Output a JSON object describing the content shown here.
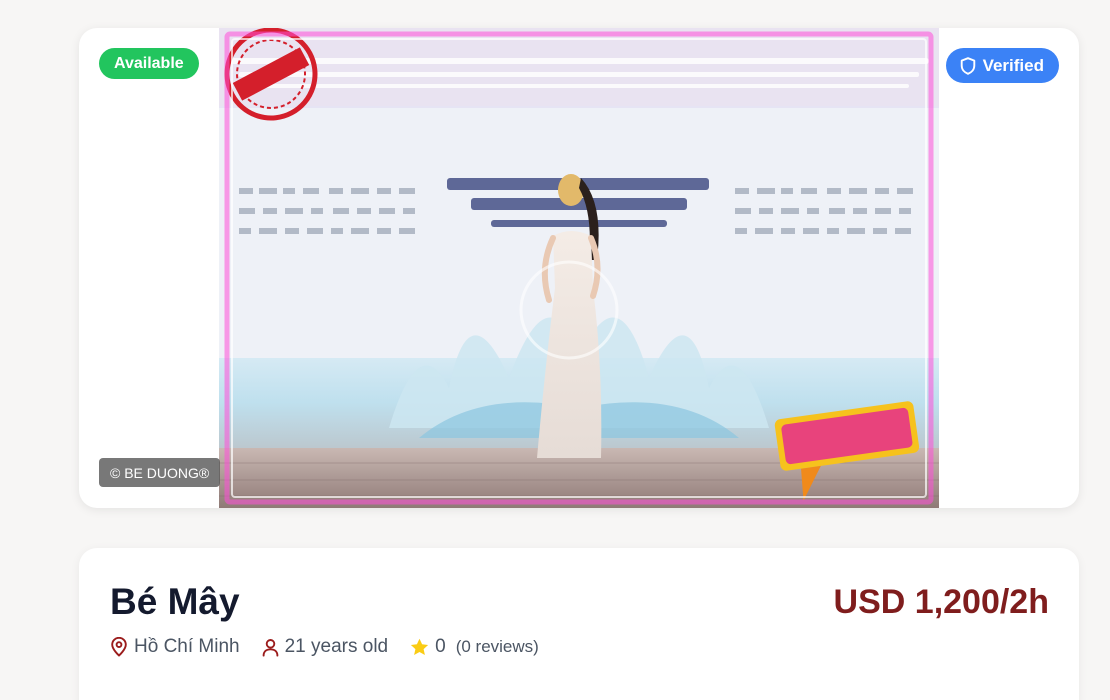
{
  "listing": {
    "status_badge": "Available",
    "verified_badge": "Verified",
    "photo_watermark": "© BE DUONG®",
    "photo_alt": "Profile photo"
  },
  "profile": {
    "name": "Bé Mây",
    "price": "USD 1,200/2h",
    "location": "Hồ Chí Minh",
    "age": "21 years old",
    "rating": "0",
    "reviews": "(0 reviews)"
  },
  "icons": {
    "verified": "shield-icon",
    "location": "map-pin-icon",
    "age": "user-icon",
    "rating": "star-icon"
  },
  "colors": {
    "available": "#22c55e",
    "verified": "#3b82f6",
    "price": "#7f1d1d",
    "accent_icon": "#9b1c1c",
    "star": "#facc15"
  }
}
